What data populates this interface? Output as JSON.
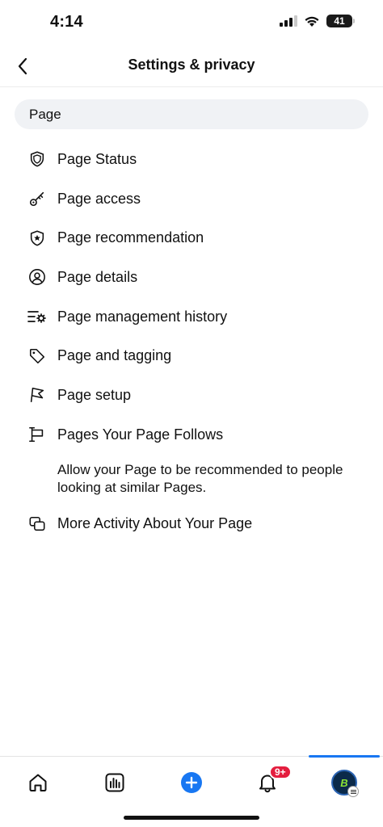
{
  "status_bar": {
    "time": "4:14",
    "battery": "41"
  },
  "header": {
    "title": "Settings & privacy",
    "back_icon": "chevron-left-icon"
  },
  "search": {
    "value": "Page"
  },
  "menu": {
    "items": [
      {
        "label": "Page Status",
        "icon": "shield-icon"
      },
      {
        "label": "Page access",
        "icon": "key-icon"
      },
      {
        "label": "Page recommendation",
        "icon": "shield-star-icon"
      },
      {
        "label": "Page details",
        "icon": "user-circle-icon"
      },
      {
        "label": "Page management history",
        "icon": "list-gear-icon"
      },
      {
        "label": "Page and tagging",
        "icon": "tag-icon"
      },
      {
        "label": "Page setup",
        "icon": "flag-icon"
      },
      {
        "label": "Pages Your Page Follows",
        "icon": "flag-post-icon"
      },
      {
        "label": "More Activity About Your Page",
        "icon": "overlap-squares-icon"
      }
    ],
    "description": "Allow your Page to be recommended to people looking at similar Pages."
  },
  "bottom_nav": {
    "items": [
      "home-icon",
      "insights-icon",
      "create-icon",
      "notifications-icon",
      "profile-menu"
    ],
    "notifications_badge": "9+",
    "active_color": "#1877f2"
  },
  "colors": {
    "accent": "#1877f2",
    "badge": "#e41e3f",
    "search_bg": "#f0f2f5"
  }
}
